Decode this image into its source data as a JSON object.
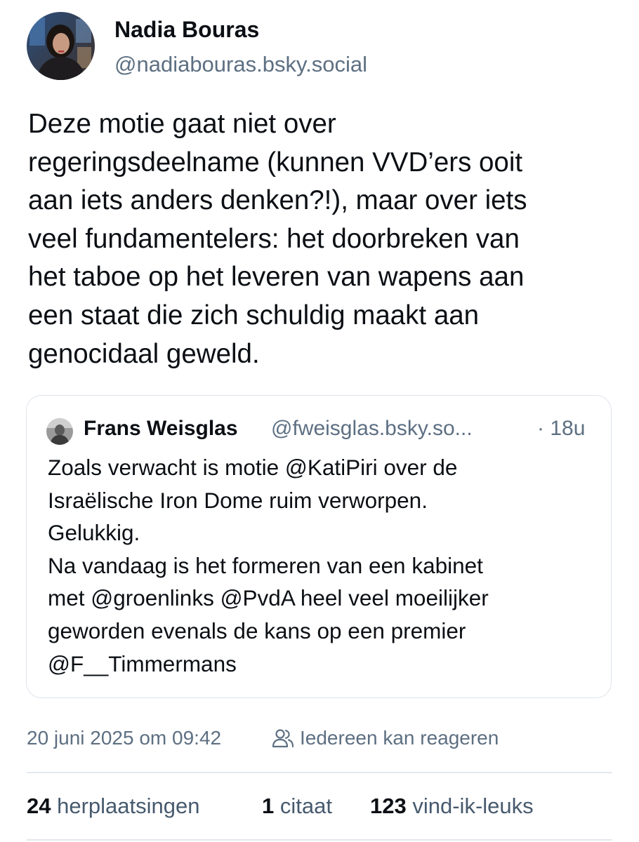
{
  "post": {
    "author": {
      "name": "Nadia Bouras",
      "handle": "@nadiabouras.bsky.social"
    },
    "text": "Deze motie gaat niet over\nregeringsdeelname (kunnen VVD’ers ooit\naan iets anders denken?!), maar over iets\nveel fundamentelers: het doorbreken van\nhet taboe op het leveren van wapens aan\neen staat die zich schuldig maakt aan\ngenocidaal geweld.",
    "quote": {
      "author_name": "Frans Weisglas",
      "author_handle": "@fweisglas.bsky.so...",
      "time": "· 18u",
      "text": "Zoals verwacht is motie @KatiPiri over de\nIsraëlische Iron Dome ruim verworpen.\nGelukkig.\nNa vandaag is het formeren van een kabinet\nmet @groenlinks @PvdA heel veel moeilijker\ngeworden evenals de kans op een premier\n@F__Timmermans"
    },
    "meta": {
      "date": "20 juni 2025 om 09:42",
      "reply_setting": "Iedereen kan reageren",
      "reply_icon": "people-icon"
    },
    "stats": {
      "reposts_count": "24",
      "reposts_label": "herplaatsingen",
      "quotes_count": "1",
      "quotes_label": "citaat",
      "likes_count": "123",
      "likes_label": "vind-ik-leuks"
    }
  },
  "colors": {
    "text": "#0b0f14",
    "muted": "#5d6f82",
    "border": "#dde3ea",
    "stat_label": "#475a6e"
  }
}
